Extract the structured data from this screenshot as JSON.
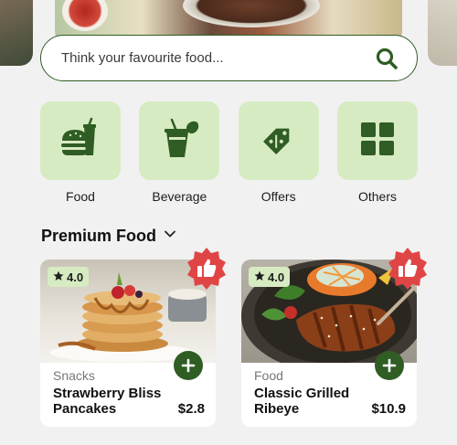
{
  "search": {
    "placeholder": "Think your favourite food..."
  },
  "categories": [
    {
      "label": "Food",
      "icon": "burger-drink-icon"
    },
    {
      "label": "Beverage",
      "icon": "beverage-cup-icon"
    },
    {
      "label": "Offers",
      "icon": "discount-tag-icon"
    },
    {
      "label": "Others",
      "icon": "grid-icon"
    }
  ],
  "section": {
    "title": "Premium Food"
  },
  "products": [
    {
      "rating": "4.0",
      "category": "Snacks",
      "name": "Strawberry Bliss Pancakes",
      "price": "$2.8"
    },
    {
      "rating": "4.0",
      "category": "Food",
      "name": "Classic Grilled Ribeye",
      "price": "$10.9"
    }
  ],
  "colors": {
    "primary": "#2f5d24",
    "tile": "#d7ebc3",
    "like": "#e04545",
    "background": "#f1f1f1"
  }
}
